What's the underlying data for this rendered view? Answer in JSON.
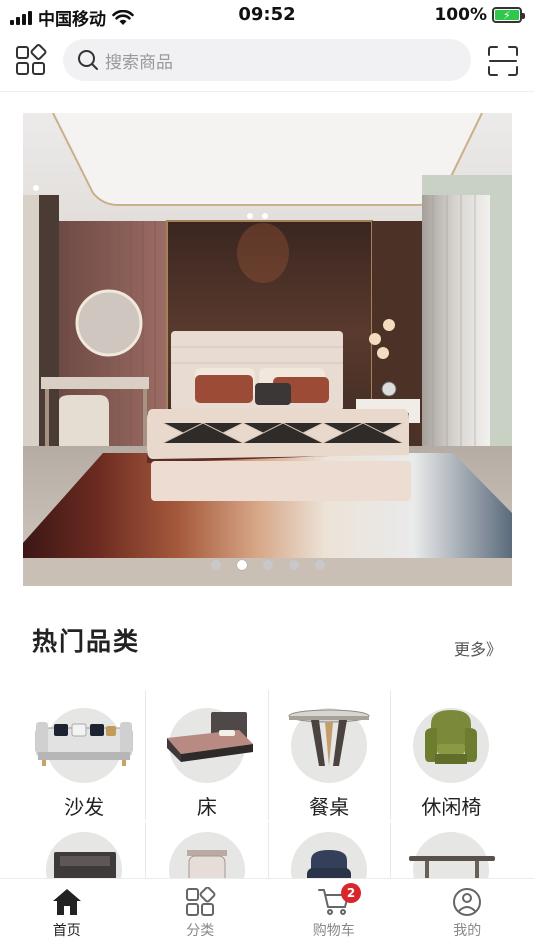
{
  "status_bar": {
    "carrier": "中国移动",
    "time": "09:52",
    "battery": "100%"
  },
  "header": {
    "search_placeholder": "搜索商品"
  },
  "banner": {
    "slide_count": 5,
    "active_slide": 2
  },
  "hot_categories": {
    "title": "热门品类",
    "more": "更多》",
    "items": [
      {
        "label": "沙发",
        "icon": "sofa-icon"
      },
      {
        "label": "床",
        "icon": "bed-icon"
      },
      {
        "label": "餐桌",
        "icon": "dining-table-icon"
      },
      {
        "label": "休闲椅",
        "icon": "lounge-chair-icon"
      }
    ]
  },
  "tabbar": {
    "items": [
      {
        "label": "首页",
        "icon": "home-icon",
        "active": true
      },
      {
        "label": "分类",
        "icon": "category-icon",
        "active": false
      },
      {
        "label": "购物车",
        "icon": "cart-icon",
        "active": false,
        "badge": "2"
      },
      {
        "label": "我的",
        "icon": "profile-icon",
        "active": false
      }
    ]
  },
  "colors": {
    "badge": "#d8262c",
    "search_bg": "#f1f1f3",
    "battery": "#2fc84a"
  }
}
